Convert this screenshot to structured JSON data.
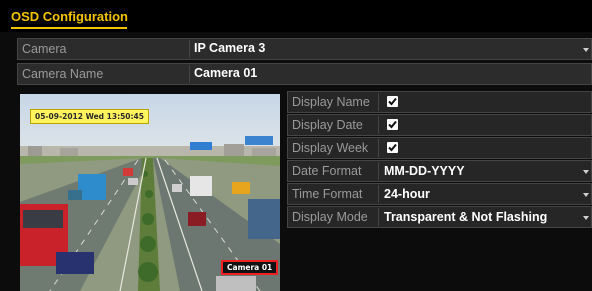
{
  "header": {
    "title": "OSD Configuration"
  },
  "camera": {
    "label": "Camera",
    "value": "IP Camera 3"
  },
  "camera_name": {
    "label": "Camera Name",
    "value": "Camera 01"
  },
  "preview": {
    "osd_date_text": "05-09-2012 Wed 13:50:45",
    "osd_name_text": "Camera 01"
  },
  "settings": [
    {
      "label": "Display Name",
      "type": "checkbox",
      "checked": true
    },
    {
      "label": "Display Date",
      "type": "checkbox",
      "checked": true
    },
    {
      "label": "Display Week",
      "type": "checkbox",
      "checked": true
    },
    {
      "label": "Date Format",
      "type": "select",
      "value": "MM-DD-YYYY"
    },
    {
      "label": "Time Format",
      "type": "select",
      "value": "24-hour"
    },
    {
      "label": "Display Mode",
      "type": "select",
      "value": "Transparent & Not Flashing"
    }
  ],
  "colors": {
    "title": "#f2c400",
    "osd_date_bg": "#fff45e",
    "osd_name_border": "#e22222"
  }
}
